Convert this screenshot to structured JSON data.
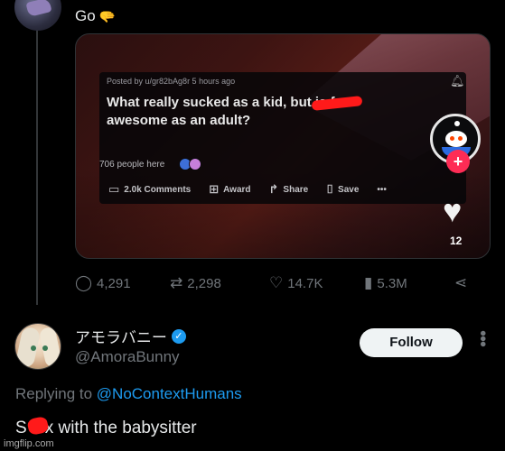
{
  "top_tweet": {
    "text": "Go",
    "emoji": "✋"
  },
  "reddit_post": {
    "posted_by": "Posted by u/gr82bAg8r 5 hours ago",
    "title": "What really sucked as a kid, but is f",
    "title_end": "awesome as an adult?",
    "people_here": "706 people here",
    "comments": "2.0k Comments",
    "award": "Award",
    "share": "Share",
    "save": "Save",
    "more": "•••",
    "side_like_count": "12"
  },
  "stats": {
    "replies": "4,291",
    "retweets": "2,298",
    "likes": "14.7K",
    "views": "5.3M"
  },
  "reply": {
    "display_name": "アモラバニー",
    "handle": "@AmoraBunny",
    "follow_label": "Follow",
    "replying_prefix": "Replying to ",
    "replying_to": "@NoContextHumans",
    "text_start": "S",
    "text_rest": "x with the babysitter"
  },
  "watermark": "imgflip.com",
  "colors": {
    "accent": "#1d9bf0",
    "muted": "#71767b",
    "censor": "#ff1a1a",
    "tiktok_red": "#fe2c55"
  }
}
